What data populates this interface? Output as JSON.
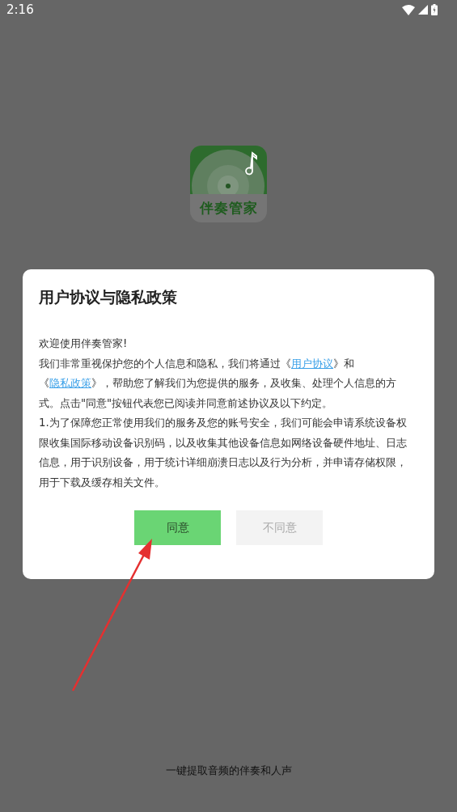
{
  "status_bar": {
    "time": "2:16"
  },
  "app": {
    "name": "伴奏管家",
    "tagline": "一键提取音频的伴奏和人声"
  },
  "dialog": {
    "title": "用户协议与隐私政策",
    "paragraphs": [
      [
        {
          "kind": "text",
          "text": "欢迎使用伴奏管家!"
        }
      ],
      [
        {
          "kind": "text",
          "text": "我们非常重视保护您的个人信息和隐私，我们将通过《"
        },
        {
          "kind": "link",
          "text": "用户协议"
        },
        {
          "kind": "text",
          "text": "》和《"
        },
        {
          "kind": "link",
          "text": "隐私政策"
        },
        {
          "kind": "text",
          "text": "》，帮助您了解我们为您提供的服务，及收集、处理个人信息的方式。点击\"同意\"按钮代表您已阅读并同意前述协议及以下约定。"
        }
      ],
      [
        {
          "kind": "text",
          "text": "1.为了保障您正常使用我们的服务及您的账号安全，我们可能会申请系统设备权限收集国际移动设备识别码，以及收集其他设备信息如网络设备硬件地址、日志信息，用于识别设备，用于统计详细崩溃日志以及行为分析，并申请存储权限，用于下载及缓存相关文件。"
        }
      ]
    ],
    "buttons": [
      {
        "label": "同意",
        "kind": "primary"
      },
      {
        "label": "不同意",
        "kind": "secondary"
      }
    ]
  }
}
